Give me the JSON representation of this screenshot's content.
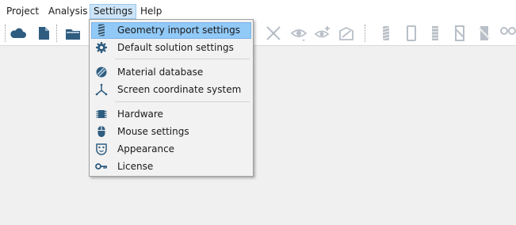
{
  "menubar": {
    "items": [
      {
        "label": "Project"
      },
      {
        "label": "Analysis"
      },
      {
        "label": "Settings"
      },
      {
        "label": "Help"
      }
    ]
  },
  "toolbar": {
    "icons": [
      "cloud-icon",
      "new-document-icon",
      "open-folder-icon",
      "measure-icon",
      "eye-icon",
      "add-view-icon",
      "view-rotate-icon",
      "coil-icon",
      "frame-icon",
      "spring-icon",
      "strip-icon",
      "cut-icon",
      "chain-icon"
    ]
  },
  "settings_menu": {
    "items": [
      {
        "label": "Geometry import settings",
        "icon": "coil-icon"
      },
      {
        "label": "Default solution settings",
        "icon": "gear-icon"
      },
      {
        "label": "Material database",
        "icon": "material-ball-icon"
      },
      {
        "label": "Screen coordinate system",
        "icon": "axes-icon"
      },
      {
        "label": "Hardware",
        "icon": "chip-icon"
      },
      {
        "label": "Mouse settings",
        "icon": "mouse-icon"
      },
      {
        "label": "Appearance",
        "icon": "mask-icon"
      },
      {
        "label": "License",
        "icon": "key-icon"
      }
    ]
  },
  "colors": {
    "menu_highlight": "#91c9f7",
    "active_menubar": "#cce4f7",
    "icon_blue": "#2f5d80",
    "toolbar_disabled": "#b8bfc7"
  }
}
